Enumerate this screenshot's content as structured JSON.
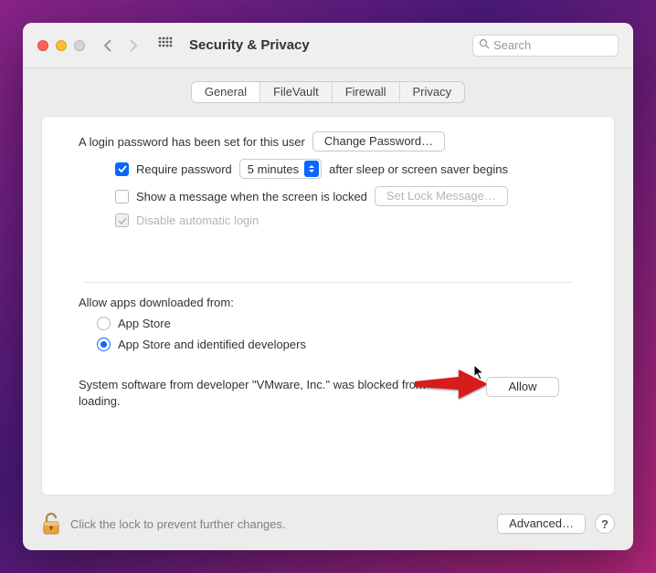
{
  "window": {
    "title": "Security & Privacy"
  },
  "search": {
    "placeholder": "Search"
  },
  "tabs": {
    "general": "General",
    "filevault": "FileVault",
    "firewall": "Firewall",
    "privacy": "Privacy"
  },
  "login": {
    "password_set": "A login password has been set for this user",
    "change_password_btn": "Change Password…",
    "require_prefix": "Require password",
    "require_delay": "5 minutes",
    "require_suffix": "after sleep or screen saver begins",
    "show_message": "Show a message when the screen is locked",
    "set_lock_msg_btn": "Set Lock Message…",
    "disable_auto_login": "Disable automatic login"
  },
  "downloads": {
    "header": "Allow apps downloaded from:",
    "app_store": "App Store",
    "identified": "App Store and identified developers"
  },
  "blocked": {
    "text": "System software from developer \"VMware, Inc.\" was blocked from loading.",
    "allow_btn": "Allow"
  },
  "footer": {
    "lock_msg": "Click the lock to prevent further changes.",
    "advanced_btn": "Advanced…"
  }
}
